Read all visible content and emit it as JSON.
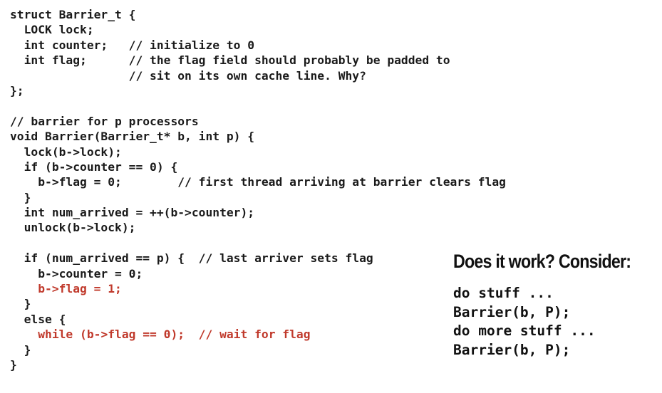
{
  "code_lines": [
    "struct Barrier_t {",
    "  LOCK lock;",
    "  int counter;   // initialize to 0",
    "  int flag;      // the flag field should probably be padded to",
    "                 // sit on its own cache line. Why?",
    "};",
    "",
    "// barrier for p processors",
    "void Barrier(Barrier_t* b, int p) {",
    "  lock(b->lock);",
    "  if (b->counter == 0) {",
    "    b->flag = 0;        // first thread arriving at barrier clears flag",
    "  }",
    "  int num_arrived = ++(b->counter);",
    "  unlock(b->lock);",
    "",
    "  if (num_arrived == p) {  // last arriver sets flag",
    "    b->counter = 0;",
    "    b->flag = 1;",
    "  }",
    "  else {",
    "    while (b->flag == 0);  // wait for flag",
    "  }",
    "}"
  ],
  "highlight_color": "#c0392b",
  "side": {
    "heading": "Does it work? Consider:",
    "lines": [
      "do stuff ...",
      "Barrier(b, P);",
      "do more stuff ...",
      "Barrier(b, P);"
    ]
  }
}
